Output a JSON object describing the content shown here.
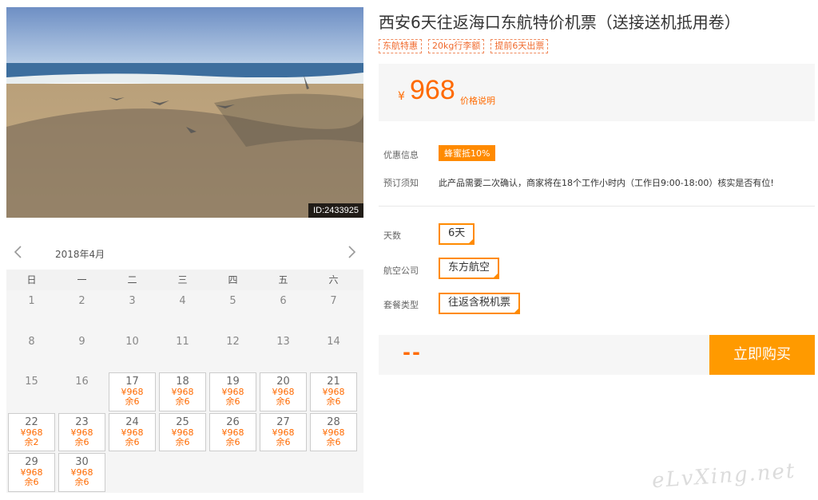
{
  "product": {
    "title": "西安6天往返海口东航特价机票（送接送机抵用卷）",
    "tags": [
      "东航特惠",
      "20kg行李额",
      "提前6天出票"
    ],
    "currency": "¥",
    "price": "968",
    "price_note": "价格说明",
    "image_id": "ID:2433925"
  },
  "info": {
    "promo_label": "优惠信息",
    "promo_badge": "蜂蜜抵10%",
    "notice_label": "预订须知",
    "notice_text": "此产品需要二次确认，商家将在18个工作小时内（工作日9:00-18:00）核实是否有位!"
  },
  "options": {
    "days_label": "天数",
    "days_value": "6天",
    "airline_label": "航空公司",
    "airline_value": "东方航空",
    "package_label": "套餐类型",
    "package_value": "往返含税机票"
  },
  "purchase": {
    "total": "--",
    "buy_label": "立即购买"
  },
  "calendar": {
    "month": "2018年4月",
    "weekdays": [
      "日",
      "一",
      "二",
      "三",
      "四",
      "五",
      "六"
    ],
    "days": [
      {
        "d": "1"
      },
      {
        "d": "2"
      },
      {
        "d": "3"
      },
      {
        "d": "4"
      },
      {
        "d": "5"
      },
      {
        "d": "6"
      },
      {
        "d": "7"
      },
      {
        "d": "8"
      },
      {
        "d": "9"
      },
      {
        "d": "10"
      },
      {
        "d": "11"
      },
      {
        "d": "12"
      },
      {
        "d": "13"
      },
      {
        "d": "14"
      },
      {
        "d": "15"
      },
      {
        "d": "16"
      },
      {
        "d": "17",
        "price": "¥968",
        "stock": "余6"
      },
      {
        "d": "18",
        "price": "¥968",
        "stock": "余6"
      },
      {
        "d": "19",
        "price": "¥968",
        "stock": "余6"
      },
      {
        "d": "20",
        "price": "¥968",
        "stock": "余6"
      },
      {
        "d": "21",
        "price": "¥968",
        "stock": "余6"
      },
      {
        "d": "22",
        "price": "¥968",
        "stock": "余2"
      },
      {
        "d": "23",
        "price": "¥968",
        "stock": "余6"
      },
      {
        "d": "24",
        "price": "¥968",
        "stock": "余6"
      },
      {
        "d": "25",
        "price": "¥968",
        "stock": "余6"
      },
      {
        "d": "26",
        "price": "¥968",
        "stock": "余6"
      },
      {
        "d": "27",
        "price": "¥968",
        "stock": "余6"
      },
      {
        "d": "28",
        "price": "¥968",
        "stock": "余6"
      },
      {
        "d": "29",
        "price": "¥968",
        "stock": "余6"
      },
      {
        "d": "30",
        "price": "¥968",
        "stock": "余6"
      }
    ]
  },
  "watermark": "eLvXing.net",
  "colors": {
    "accent": "#ff8a00",
    "price": "#ff6a00"
  },
  "icons": {
    "prev": "chevron-left-icon",
    "next": "chevron-right-icon"
  }
}
